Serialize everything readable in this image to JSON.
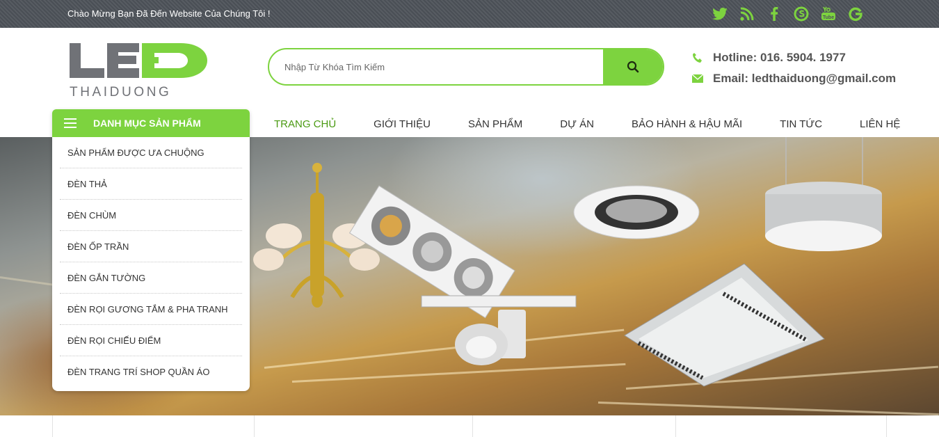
{
  "topbar": {
    "welcome": "Chào Mừng Bạn Đã Đến Website Của Chúng Tôi !",
    "social_icons": [
      "twitter-icon",
      "rss-icon",
      "facebook-icon",
      "skype-icon",
      "youtube-icon",
      "google-icon"
    ]
  },
  "logo": {
    "top": "LED",
    "bottom": "THAIDUONG"
  },
  "search": {
    "placeholder": "Nhập Từ Khóa Tìm Kiếm",
    "value": ""
  },
  "contact": {
    "hotline_label": "Hotline:",
    "hotline": "016. 5904. 1977",
    "email_label": "Email:",
    "email": "ledthaiduong@gmail.com"
  },
  "category": {
    "title": "DANH MỤC SẢN PHẨM",
    "items": [
      "Sản phẩm được ưa chuộng",
      "Đèn thả",
      "Đèn chùm",
      "Đèn ốp trần",
      "Đèn gắn tường",
      "Đèn rọi gương tắm & pha tranh",
      "Đèn rọi chiếu điểm",
      "Đèn trang trí shop quần áo"
    ]
  },
  "nav": {
    "items": [
      "TRANG CHỦ",
      "GIỚI THIỆU",
      "SẢN PHẨM",
      "DỰ ÁN",
      "BẢO HÀNH & HẬU MÃI",
      "TIN TỨC",
      "LIÊN HỆ"
    ],
    "active_index": 0
  },
  "colors": {
    "accent": "#7dd33f",
    "topbar": "#4e535a",
    "nav_active": "#4a9a12",
    "logo_gray": "#707277"
  }
}
